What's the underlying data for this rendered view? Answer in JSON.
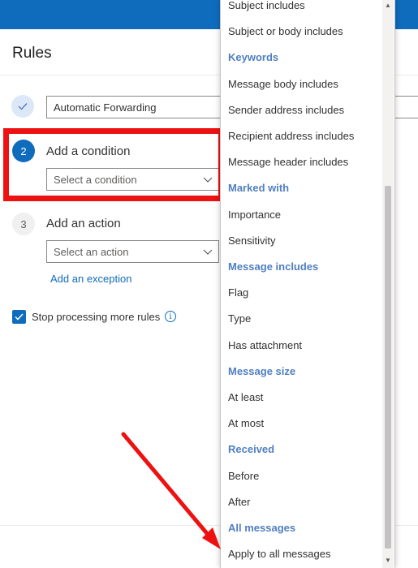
{
  "page": {
    "title": "Rules"
  },
  "steps": {
    "one": {
      "rule_name_value": "Automatic Forwarding"
    },
    "two": {
      "number": "2",
      "label": "Add a condition",
      "placeholder": "Select a condition"
    },
    "three": {
      "number": "3",
      "label": "Add an action",
      "placeholder": "Select an action"
    }
  },
  "exception_link": "Add an exception",
  "stop_processing": {
    "label": "Stop processing more rules",
    "checked": true
  },
  "dropdown": {
    "items": [
      {
        "text": "Subject includes",
        "kind": "option"
      },
      {
        "text": "Subject or body includes",
        "kind": "option"
      },
      {
        "text": "Keywords",
        "kind": "header"
      },
      {
        "text": "Message body includes",
        "kind": "option"
      },
      {
        "text": "Sender address includes",
        "kind": "option"
      },
      {
        "text": "Recipient address includes",
        "kind": "option"
      },
      {
        "text": "Message header includes",
        "kind": "option"
      },
      {
        "text": "Marked with",
        "kind": "header"
      },
      {
        "text": "Importance",
        "kind": "option"
      },
      {
        "text": "Sensitivity",
        "kind": "option"
      },
      {
        "text": "Message includes",
        "kind": "header"
      },
      {
        "text": "Flag",
        "kind": "option"
      },
      {
        "text": "Type",
        "kind": "option"
      },
      {
        "text": "Has attachment",
        "kind": "option"
      },
      {
        "text": "Message size",
        "kind": "header"
      },
      {
        "text": "At least",
        "kind": "option"
      },
      {
        "text": "At most",
        "kind": "option"
      },
      {
        "text": "Received",
        "kind": "header"
      },
      {
        "text": "Before",
        "kind": "option"
      },
      {
        "text": "After",
        "kind": "option"
      },
      {
        "text": "All messages",
        "kind": "header"
      },
      {
        "text": "Apply to all messages",
        "kind": "option"
      }
    ]
  },
  "colors": {
    "accent": "#0f6cbd",
    "header_text": "#4f7fc0",
    "highlight": "#ee1111"
  },
  "icons": {
    "step1": "checkmark-icon",
    "checkbox": "checkmark-icon",
    "info": "info-icon",
    "chevron": "chevron-down-icon"
  }
}
